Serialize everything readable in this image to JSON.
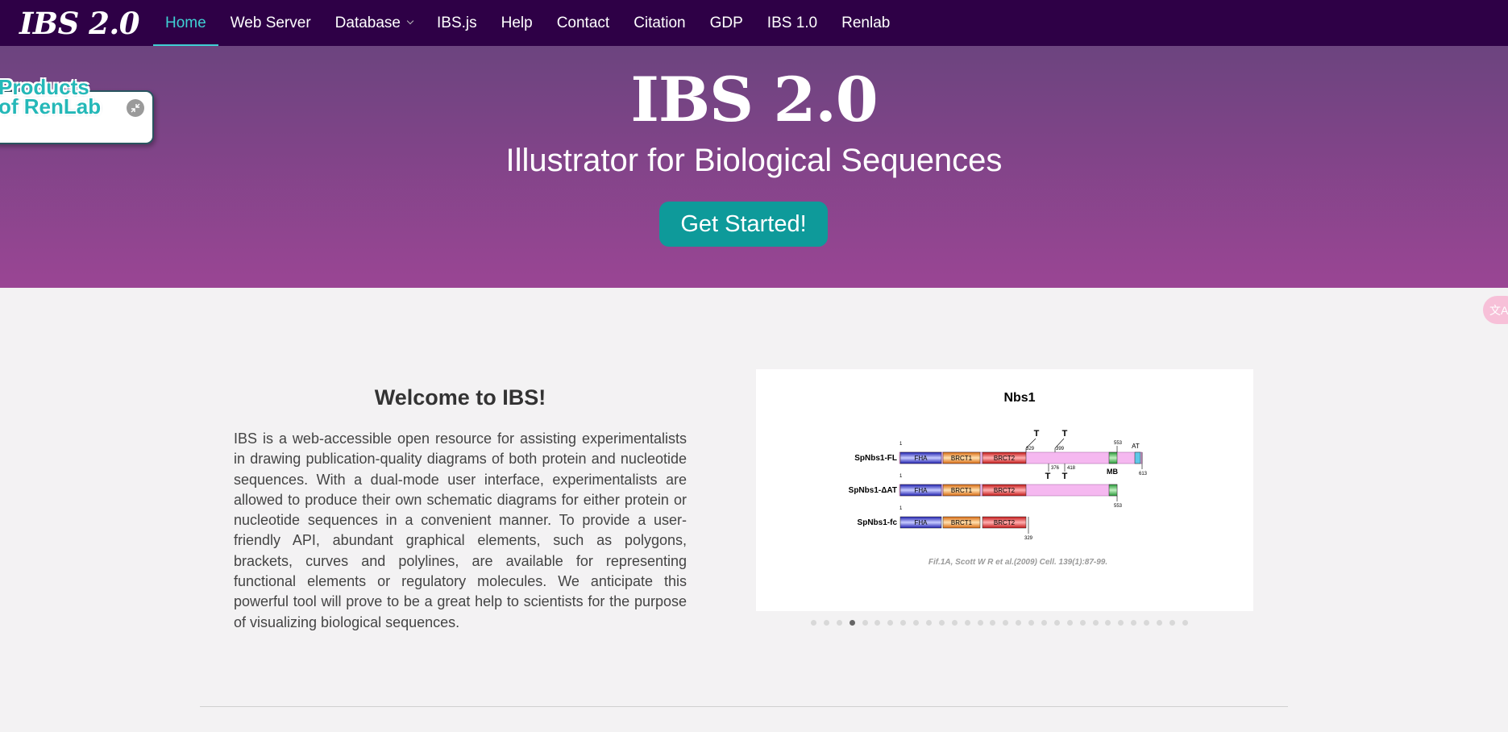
{
  "nav": {
    "brand": "IBS 2.0",
    "items": [
      {
        "label": "Home",
        "active": true
      },
      {
        "label": "Web Server"
      },
      {
        "label": "Database",
        "dropdown": true
      },
      {
        "label": "IBS.js"
      },
      {
        "label": "Help"
      },
      {
        "label": "Contact"
      },
      {
        "label": "Citation"
      },
      {
        "label": "GDP"
      },
      {
        "label": "IBS 1.0"
      },
      {
        "label": "Renlab"
      }
    ]
  },
  "hero": {
    "title": "IBS 2.0",
    "subtitle": "Illustrator for Biological Sequences",
    "cta_label": "Get Started!"
  },
  "renlab_widget": {
    "logo_line1": "Products",
    "logo_line2": "of RenLab",
    "collapse_icon": "collapse-arrows-icon"
  },
  "translate_tab": {
    "icon": "translate-icon",
    "glyph": "文A"
  },
  "welcome": {
    "title": "Welcome to IBS!",
    "text": "IBS is a web-accessible open resource for assisting experimentalists in drawing publication-quality diagrams of both protein and nucleotide sequences. With a dual-mode user interface, experimentalists are allowed to produce their own schematic diagrams for either protein or nucleotide sequences in a convenient manner. To provide a user-friendly API, abundant graphical elements, such as polygons, brackets, curves and polylines, are available for representing functional elements or regulatory molecules. We anticipate this powerful tool will prove to be a great help to scientists for the purpose of visualizing biological sequences."
  },
  "carousel": {
    "slide_title": "Nbs1",
    "proteins": [
      {
        "name": "SpNbs1-FL",
        "start": "1",
        "end": "613"
      },
      {
        "name": "SpNbs1-ΔAT",
        "start": "1",
        "end": "553"
      },
      {
        "name": "SpNbs1-fc",
        "start": "1",
        "end": "329"
      }
    ],
    "domains": [
      "FHA",
      "BRCT1",
      "BRCT2"
    ],
    "annotations": {
      "t_label": "T",
      "mb_label": "MB",
      "at_label": "AT",
      "pos_329": "329",
      "pos_399": "399",
      "pos_553": "553",
      "pos_376": "376",
      "pos_418": "418"
    },
    "caption": "Fif.1A, Scott  W R et al.(2009) Cell. 139(1):87-99.",
    "dot_count": 30,
    "active_dot": 3
  },
  "colors": {
    "navbar": "#2e0046",
    "accent": "#3fd0d4",
    "cta": "#0e9a9a",
    "hero_top": "#6c447f",
    "hero_bottom": "#9a4594"
  }
}
